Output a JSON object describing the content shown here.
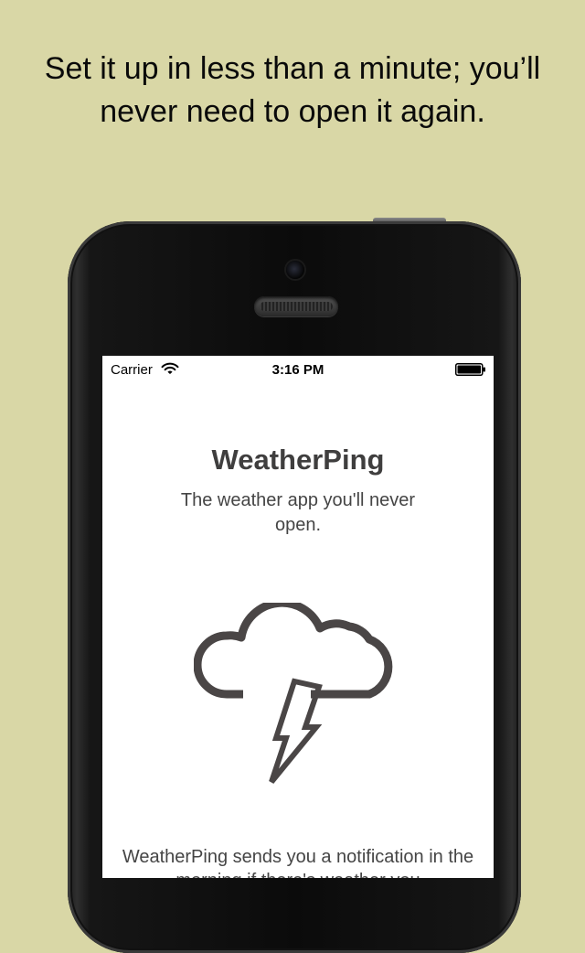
{
  "headline": "Set it up in less than a minute; you’ll never need to open it again.",
  "status_bar": {
    "carrier": "Carrier",
    "time": "3:16 PM"
  },
  "app": {
    "title": "WeatherPing",
    "subtitle": "The weather app you'll never open.",
    "description": "WeatherPing sends you a notification in the morning if there's weather you"
  },
  "icons": {
    "wifi": "wifi-icon",
    "battery": "battery-icon",
    "storm": "thunderstorm-cloud-icon"
  },
  "colors": {
    "background": "#d9d7a6",
    "icon_stroke": "#4a4646",
    "text": "#454545"
  }
}
